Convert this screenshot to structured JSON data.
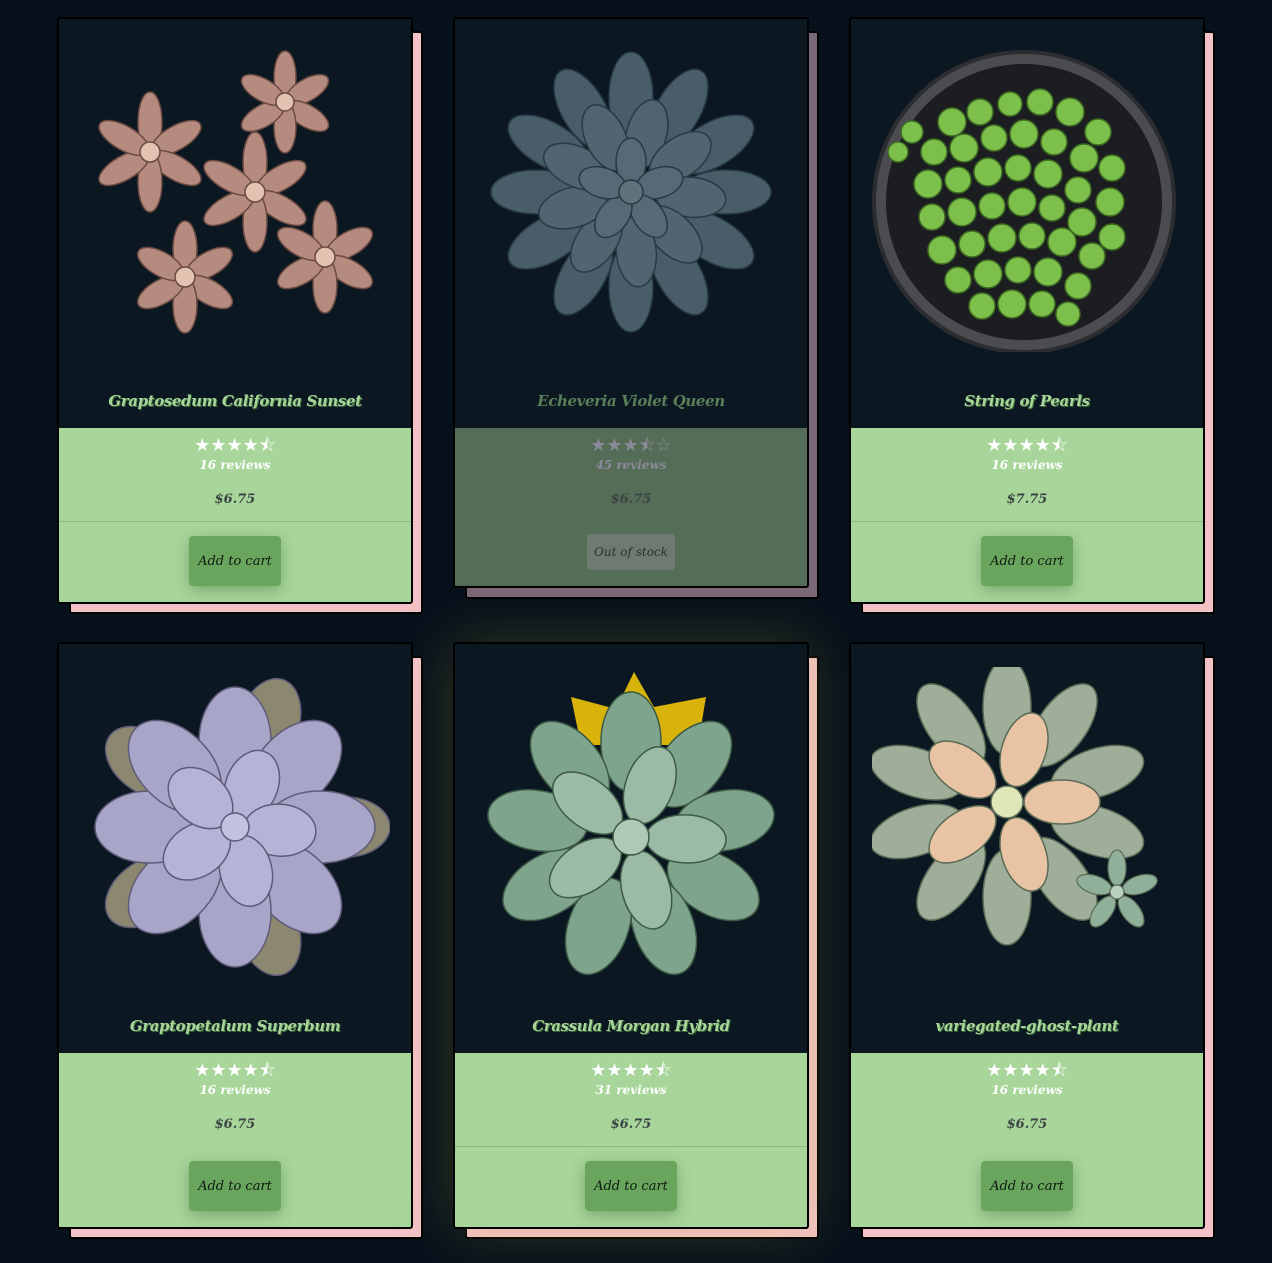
{
  "products": [
    {
      "name": "Graptosedum California Sunset",
      "rating": 4.5,
      "stars": "★★★★⯪",
      "reviews": "16 reviews",
      "price": "$6.75",
      "button": "Add to cart",
      "in_stock": true
    },
    {
      "name": "Echeveria Violet Queen",
      "rating": 3.5,
      "stars": "★★★⯪☆",
      "reviews": "45 reviews",
      "price": "$6.75",
      "button": "Out of stock",
      "in_stock": false
    },
    {
      "name": "String of Pearls",
      "rating": 4.5,
      "stars": "★★★★⯪",
      "reviews": "16 reviews",
      "price": "$7.75",
      "button": "Add to cart",
      "in_stock": true
    },
    {
      "name": "Graptopetalum Superbum",
      "rating": 4.5,
      "stars": "★★★★⯪",
      "reviews": "16 reviews",
      "price": "$6.75",
      "button": "Add to cart",
      "in_stock": true
    },
    {
      "name": "Crassula Morgan Hybrid",
      "rating": 4.5,
      "stars": "★★★★⯪",
      "reviews": "31 reviews",
      "price": "$6.75",
      "button": "Add to cart",
      "in_stock": true,
      "badge": "crown-icon"
    },
    {
      "name": "variegated-ghost-plant",
      "rating": 4.5,
      "stars": "★★★★⯪",
      "reviews": "16 reviews",
      "price": "$6.75",
      "button": "Add to cart",
      "in_stock": true
    }
  ],
  "colors": {
    "page_bg": "#07111c",
    "card_bg": "#0b1822",
    "info_bg": "#a8d59a",
    "button_bg": "#6aa55d",
    "card_shadow": "#f4c2c6"
  }
}
